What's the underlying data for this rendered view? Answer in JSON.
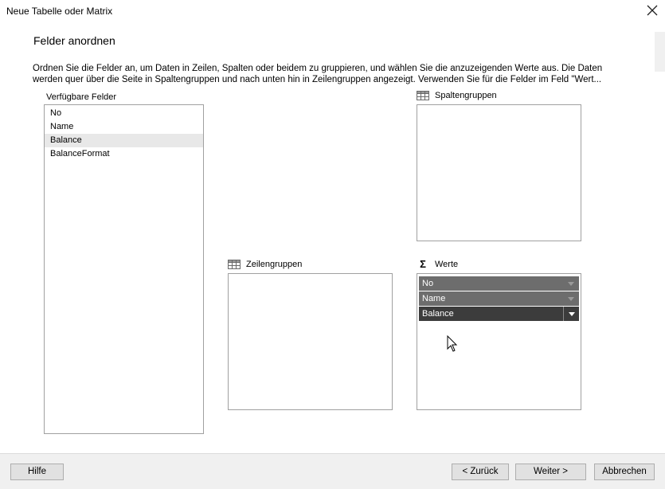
{
  "window": {
    "title": "Neue Tabelle oder Matrix"
  },
  "page": {
    "heading": "Felder anordnen",
    "description_line1": "Ordnen Sie die Felder an, um Daten in Zeilen, Spalten oder beidem zu gruppieren, und wählen Sie die anzuzeigenden Werte aus. Die Daten",
    "description_line2": "werden quer über die Seite in Spaltengruppen und nach unten hin in Zeilengruppen angezeigt. Verwenden Sie für die Felder im Feld \"Wert..."
  },
  "available_fields": {
    "label": "Verfügbare Felder",
    "items": [
      "No",
      "Name",
      "Balance",
      "BalanceFormat"
    ],
    "selected_index": 2
  },
  "column_groups": {
    "label": "Spaltengruppen"
  },
  "row_groups": {
    "label": "Zeilengruppen"
  },
  "values": {
    "label": "Werte",
    "sigma": "Σ",
    "items": [
      "No",
      "Name",
      "Balance"
    ]
  },
  "buttons": {
    "help": "Hilfe",
    "back": "< Zurück",
    "next": "Weiter >",
    "cancel": "Abbrechen"
  },
  "icons": {
    "close": "close-icon",
    "grid": "table-grid-icon",
    "dropdown": "chevron-down-icon",
    "cursor": "mouse-pointer-icon"
  },
  "colors": {
    "value_row": "#6d6d6d",
    "value_row_active": "#3c3c3c",
    "footer_bg": "#f0f0f0"
  }
}
